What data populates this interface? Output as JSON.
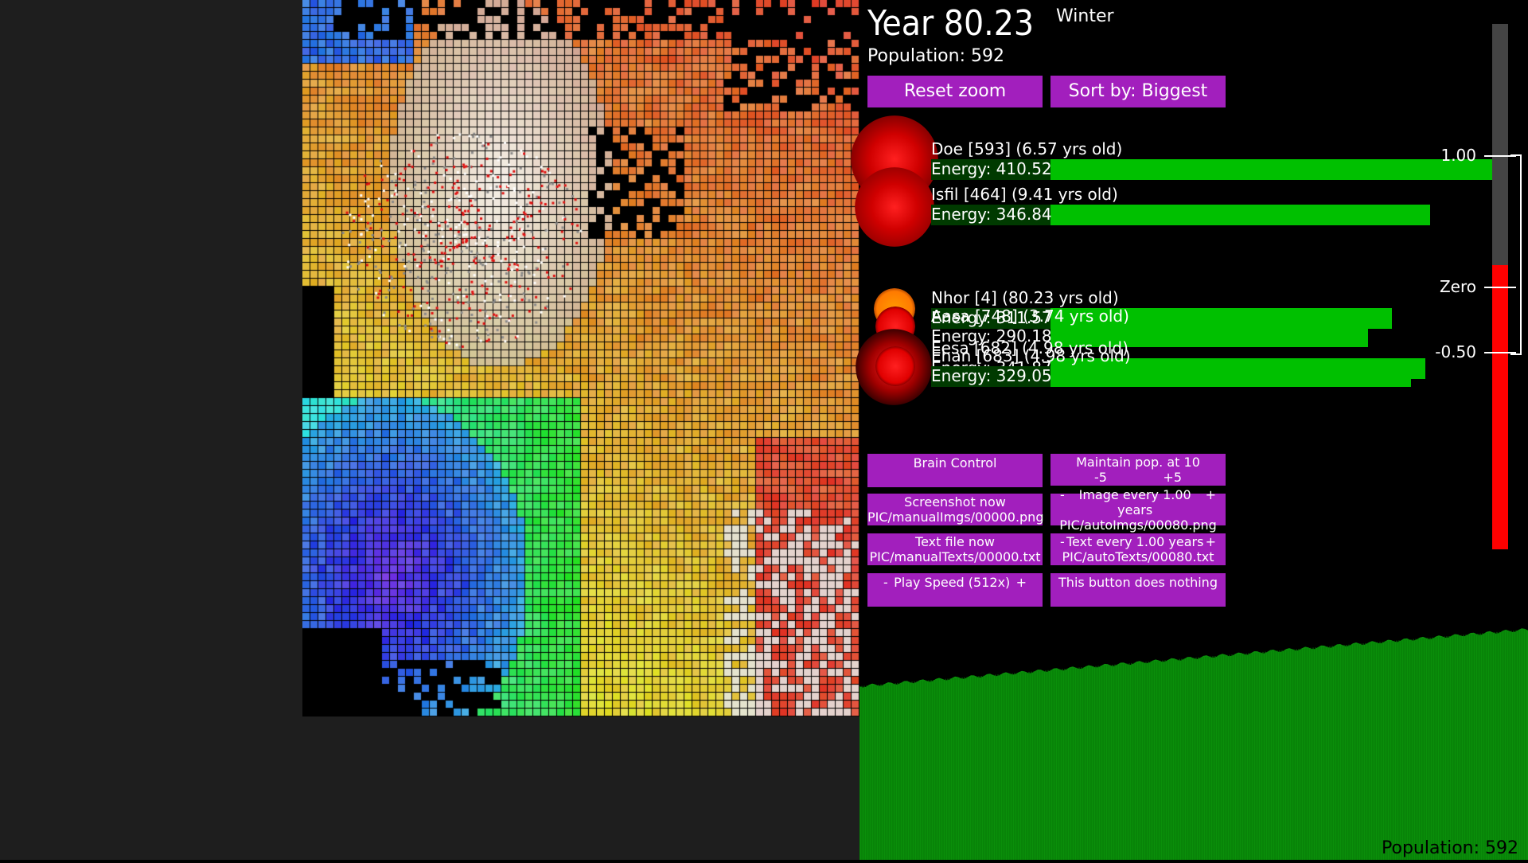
{
  "header": {
    "year": "Year 80.23",
    "season": "Winter",
    "population": "Population: 592"
  },
  "controls": {
    "reset_zoom": "Reset zoom",
    "sort_by": "Sort by: Biggest"
  },
  "creatures": [
    {
      "name": "Doe [593] (6.57 yrs old)",
      "energy": "Energy: 410.52",
      "energy_value": 410.52,
      "color": "#ff1010"
    },
    {
      "name": "Isfil [464] (9.41 yrs old)",
      "energy": "Energy: 346.84",
      "energy_value": 346.84,
      "color": "#ff1010"
    },
    {
      "name": "Nhor [4] (80.23 yrs old)",
      "energy": "Energy: 311.57",
      "energy_value": 311.57,
      "color": "#ff8c00"
    },
    {
      "name": "Aasa [748] (3.74 yrs old)",
      "energy": "Energy: 290.18",
      "energy_value": 290.18,
      "color": "#ff1010"
    },
    {
      "name": "Eesa [682] (4.98 yrs old)",
      "energy": "Energy: 341.87",
      "energy_value": 341.87,
      "color": "#ff1010"
    },
    {
      "name": "Ehan [683] (4.98 yrs old)",
      "energy": "Energy: 329.05",
      "energy_value": 329.05,
      "color": "#ff1010"
    }
  ],
  "buttons": {
    "brain_control": "Brain Control",
    "maintain_pop": "Maintain pop. at 10",
    "maintain_minus": "-5",
    "maintain_plus": "+5",
    "screenshot_line1": "Screenshot now",
    "screenshot_line2": "PIC/manualImgs/00000.png",
    "image_every_line1": "Image every 1.00 years",
    "image_every_line2": "PIC/autoImgs/00080.png",
    "textfile_line1": "Text file now",
    "textfile_line2": "PIC/manualTexts/00000.txt",
    "text_every_line1": "Text every 1.00 years",
    "text_every_line2": "PIC/autoTexts/00080.txt",
    "play_speed": "Play Speed (512x)",
    "nothing": "This button does nothing",
    "minus": "-",
    "plus": "+"
  },
  "scale": {
    "top_label": "1.00",
    "zero_label": "Zero",
    "bottom_label": "-0.50",
    "value_fraction": 0.54
  },
  "graph": {
    "label": "Population: 592"
  },
  "colors": {
    "button": "#a21fbd",
    "energy_bar": "#00c000",
    "graph": "#0a8f0a",
    "scale_fill": "#ff0000"
  }
}
